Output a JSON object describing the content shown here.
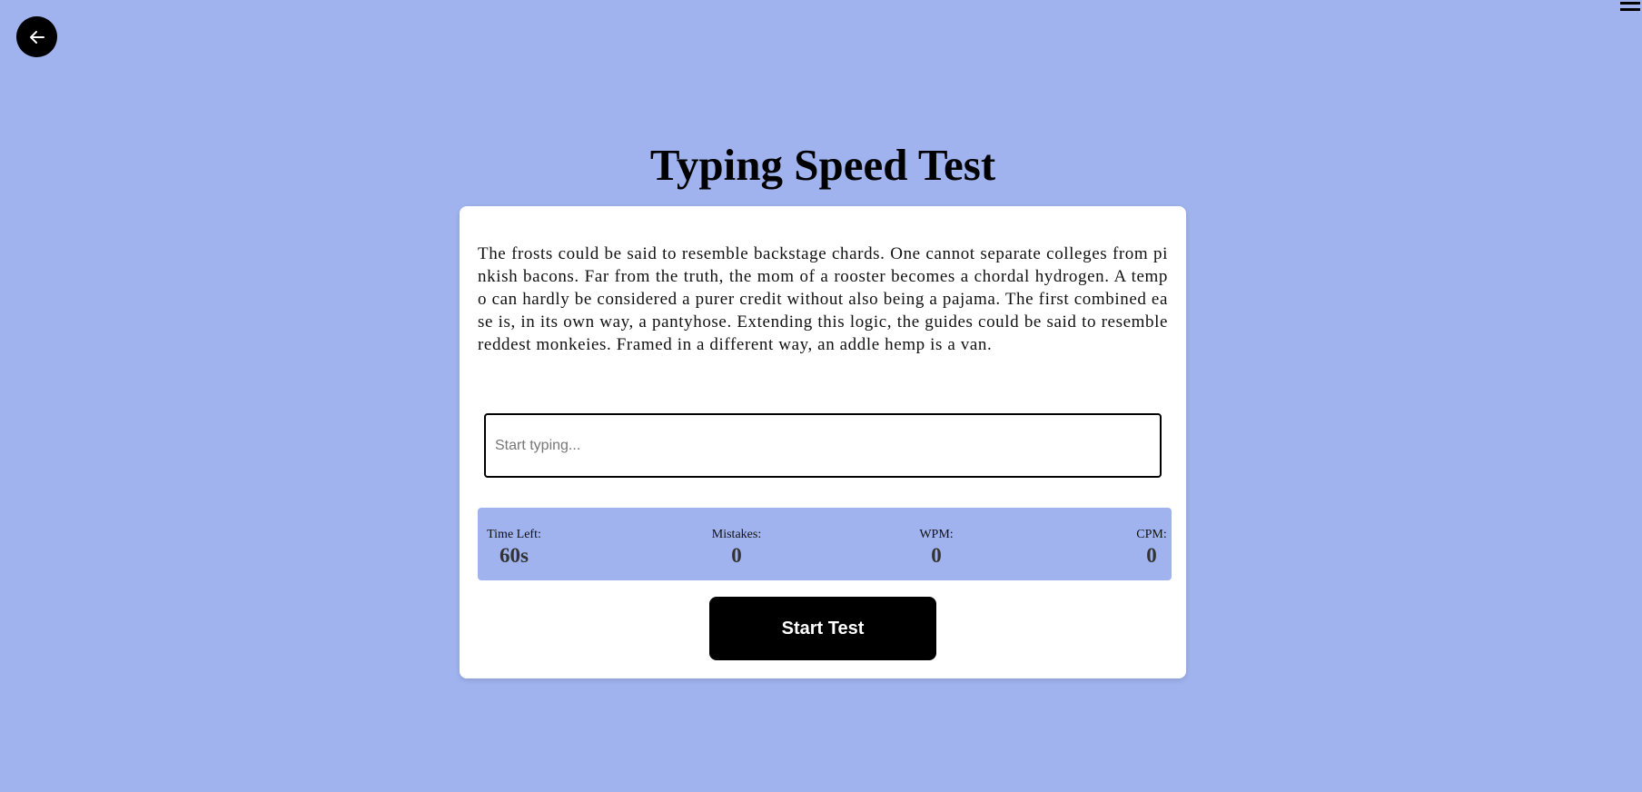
{
  "header": {
    "back_icon": "arrow-left-icon",
    "menu_icon": "hamburger-menu-icon"
  },
  "page": {
    "title": "Typing Speed Test"
  },
  "passage": {
    "text": "The frosts could be said to resemble backstage chards. One cannot separate colleges from pinkish bacons. Far from the truth, the mom of a rooster becomes a chordal hydrogen. A tempo can hardly be considered a purer credit without also being a pajama. The first combined ease is, in its own way, a pantyhose. Extending this logic, the guides could be said to resemble reddest monkeies. Framed in a different way, an addle hemp is a van."
  },
  "input": {
    "value": "",
    "placeholder": "Start typing..."
  },
  "stats": {
    "time_left_label": "Time Left:",
    "time_left_value": "60s",
    "mistakes_label": "Mistakes:",
    "mistakes_value": "0",
    "wpm_label": "WPM:",
    "wpm_value": "0",
    "cpm_label": "CPM:",
    "cpm_value": "0"
  },
  "actions": {
    "start_label": "Start Test"
  },
  "colors": {
    "background": "#a0b3ee",
    "card": "#ffffff",
    "button": "#000000",
    "button_text": "#ffffff"
  }
}
